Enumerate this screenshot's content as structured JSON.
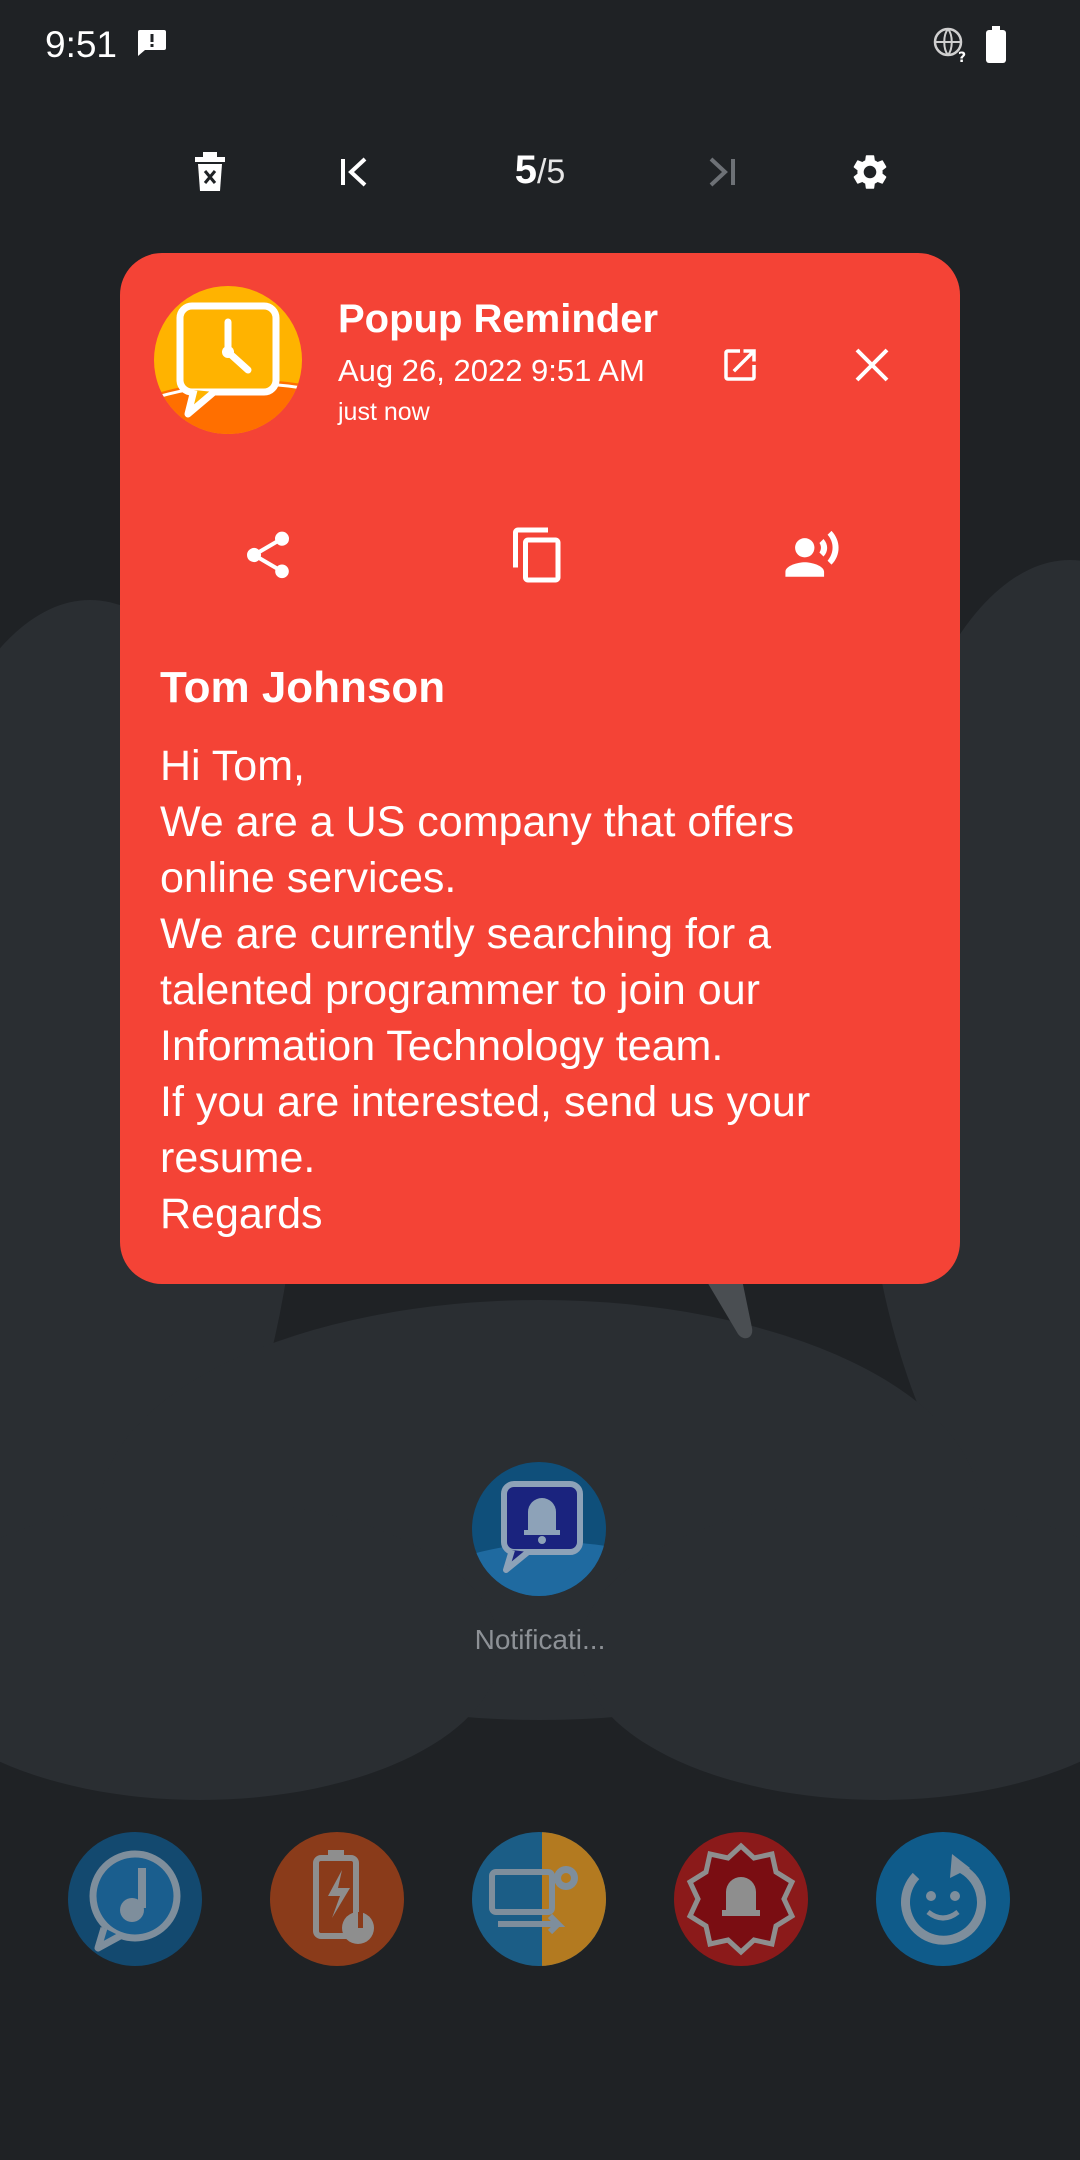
{
  "status_bar": {
    "time": "9:51",
    "icons": [
      "message-alert-icon",
      "globe-unknown-icon",
      "battery-icon"
    ]
  },
  "toolbar": {
    "delete_icon": "delete-icon",
    "first_icon": "skip-first-icon",
    "current_page": "5",
    "total_pages": "/5",
    "last_icon": "skip-last-icon",
    "settings_icon": "settings-icon"
  },
  "popup": {
    "background_color": "#f44336",
    "app_name": "Popup Reminder",
    "date": "Aug 26, 2022 9:51 AM",
    "relative_time": "just now",
    "sender": "Tom Johnson",
    "message": "Hi Tom,\nWe are a US company that offers online services.\nWe are currently searching for a talented programmer to join our Information Technology team.\nIf you are interested, send us your resume.\nRegards",
    "actions": [
      "share-icon",
      "copy-icon",
      "speak-icon"
    ]
  },
  "home": {
    "app_label": "Notificati...",
    "dock": [
      "music-reminder-icon",
      "battery-sound-icon",
      "settings-transfer-icon",
      "alarm-badge-icon",
      "refresh-face-icon"
    ]
  }
}
